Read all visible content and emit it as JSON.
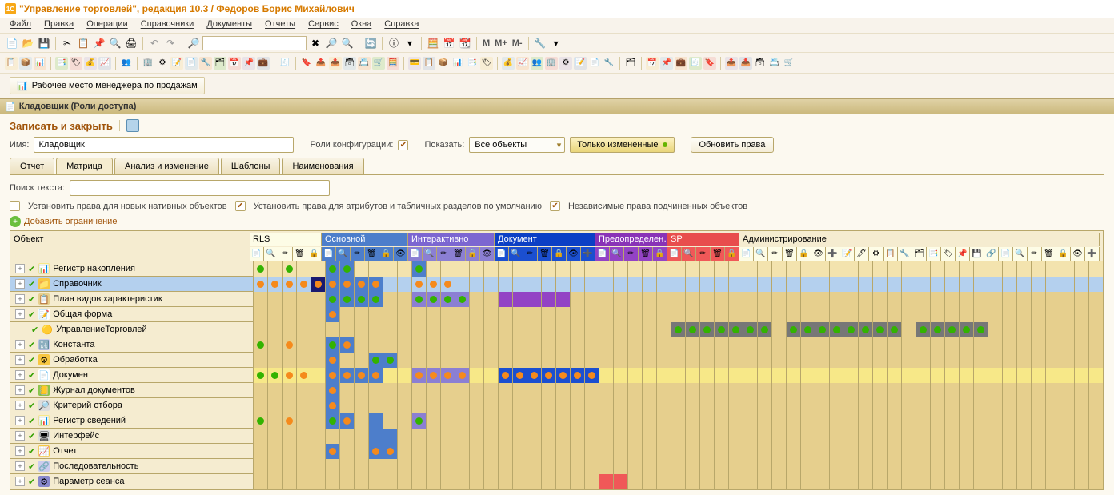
{
  "app_title": "\"Управление торговлей\", редакция 10.3 / Федоров Борис Михайлович",
  "menu": [
    "Файл",
    "Правка",
    "Операции",
    "Справочники",
    "Документы",
    "Отчеты",
    "Сервис",
    "Окна",
    "Справка"
  ],
  "m_btns": [
    "M",
    "M+",
    "M-"
  ],
  "workplace_button": "Рабочее место менеджера по продажам",
  "tab_title": "Кладовщик (Роли доступа)",
  "save_close": "Записать и закрыть",
  "labels": {
    "name": "Имя:",
    "name_value": "Кладовщик",
    "roles_config": "Роли конфигурации:",
    "show": "Показать:",
    "all_objects": "Все объекты",
    "only_changed": "Только измененные",
    "refresh_rights": "Обновить права",
    "search_text": "Поиск текста:",
    "set_native": "Установить права для новых нативных объектов",
    "set_attrs": "Установить права для атрибутов и табличных разделов по умолчанию",
    "independent": "Независимые права подчиненных объектов",
    "add_restriction": "Добавить ограничение"
  },
  "tabs": [
    "Отчет",
    "Матрица",
    "Анализ и изменение",
    "Шаблоны",
    "Наименования"
  ],
  "matrix_headers": {
    "object": "Объект",
    "groups": [
      {
        "label": "RLS",
        "class": "hdr-rls",
        "cols": 5
      },
      {
        "label": "Основной",
        "class": "hdr-main",
        "cols": 6
      },
      {
        "label": "Интерактивно",
        "class": "hdr-inter",
        "cols": 6
      },
      {
        "label": "Документ",
        "class": "hdr-doc",
        "cols": 7
      },
      {
        "label": "Предопределен…",
        "class": "hdr-predef",
        "cols": 5
      },
      {
        "label": "SP",
        "class": "hdr-sp",
        "cols": 5
      },
      {
        "label": "Администрирование",
        "class": "hdr-admin",
        "cols": 25
      }
    ]
  },
  "rows": [
    {
      "icon": "📊",
      "icon_bg": "#f7e888",
      "label": "Регистр накопления",
      "base": "bg-tan-lt",
      "cells": {
        "0": "g",
        "2": "g",
        "5": "g-azure",
        "6": "g-azure",
        "11": "g-azure"
      }
    },
    {
      "icon": "📁",
      "icon_bg": "#f7c742",
      "label": "Справочник",
      "base": "bg-lblue",
      "cells": {
        "0": "o",
        "1": "o",
        "2": "o",
        "3": "o",
        "4": "o-dk",
        "5": "o-azure",
        "6": "o-azure",
        "7": "o-azure",
        "8": "o-azure",
        "11": "o",
        "12": "o",
        "13": "o"
      }
    },
    {
      "icon": "📋",
      "icon_bg": "#e6cf8d",
      "label": "План видов характеристик",
      "base": "bg-tan",
      "cells": {
        "5": "g-azure",
        "6": "g-azure",
        "7": "g-azure",
        "8": "g-azure",
        "11": "g-lpurple",
        "12": "g-lpurple",
        "13": "g-lpurple",
        "14": "g-lpurple",
        "17": "-purple",
        "18": "-purple",
        "19": "-purple",
        "20": "-purple",
        "21": "-purple"
      }
    },
    {
      "icon": "📝",
      "icon_bg": "#fff",
      "label": "Общая форма",
      "base": "bg-tan",
      "cells": {
        "5": "o-azure"
      }
    },
    {
      "icon": "🟡",
      "icon_bg": "",
      "label": "УправлениеТорговлей",
      "base": "bg-tan",
      "indent": true,
      "cells": {
        "29": "g-gray",
        "30": "g-gray",
        "31": "g-gray",
        "32": "g-gray",
        "33": "g-gray",
        "34": "g-gray",
        "35": "g-gray",
        "37": "g-gray",
        "38": "g-gray",
        "39": "g-gray",
        "40": "g-gray",
        "41": "g-gray",
        "42": "g-gray",
        "43": "g-gray",
        "44": "g-gray",
        "46": "g-gray",
        "47": "g-gray",
        "48": "g-gray",
        "49": "g-gray",
        "50": "g-gray"
      }
    },
    {
      "icon": "🔣",
      "icon_bg": "#cce",
      "label": "Константа",
      "base": "bg-tan",
      "cells": {
        "0": "g",
        "2": "o",
        "5": "g-azure",
        "6": "o-azure"
      }
    },
    {
      "icon": "⚙",
      "icon_bg": "#f7c742",
      "label": "Обработка",
      "base": "bg-tan",
      "cells": {
        "5": "o-azure",
        "8": "g-azure",
        "9": "g-azure"
      }
    },
    {
      "icon": "📄",
      "icon_bg": "#fff",
      "label": "Документ",
      "base": "bg-yellow",
      "cells": {
        "0": "g",
        "1": "g",
        "2": "o",
        "3": "o",
        "5": "o-azure",
        "6": "o-azure",
        "7": "o-azure",
        "8": "o-azure",
        "11": "o-lpurple",
        "12": "o-lpurple",
        "13": "o-lpurple",
        "14": "o-lpurple",
        "17": "o-blue",
        "18": "o-blue",
        "19": "o-blue",
        "20": "o-blue",
        "21": "o-blue",
        "22": "o-blue",
        "23": "o-blue"
      }
    },
    {
      "icon": "📒",
      "icon_bg": "#8bc34a",
      "label": "Журнал документов",
      "base": "bg-tan",
      "cells": {
        "5": "o-azure"
      }
    },
    {
      "icon": "🔎",
      "icon_bg": "#ddd",
      "label": "Критерий отбора",
      "base": "bg-tan",
      "cells": {
        "5": "o-azure"
      }
    },
    {
      "icon": "📊",
      "icon_bg": "#f7e888",
      "label": "Регистр сведений",
      "base": "bg-tan",
      "cells": {
        "0": "g",
        "2": "o",
        "5": "g-azure",
        "6": "o-azure",
        "8": "-azure",
        "11": "g-lpurple"
      }
    },
    {
      "icon": "🖥",
      "icon_bg": "#ddd",
      "label": "Интерфейс",
      "base": "bg-tan",
      "cells": {
        "8": "-azure",
        "9": "-azure"
      }
    },
    {
      "icon": "📈",
      "icon_bg": "#f7c742",
      "label": "Отчет",
      "base": "bg-tan",
      "cells": {
        "5": "o-azure",
        "8": "o-azure",
        "9": "o-azure"
      }
    },
    {
      "icon": "🔗",
      "icon_bg": "#cce",
      "label": "Последовательность",
      "base": "bg-tan",
      "cells": {}
    },
    {
      "icon": "⚙",
      "icon_bg": "#88c",
      "label": "Параметр сеанса",
      "base": "bg-tan",
      "cells": {
        "24": "-red",
        "25": "-red"
      },
      "partial": true
    }
  ]
}
